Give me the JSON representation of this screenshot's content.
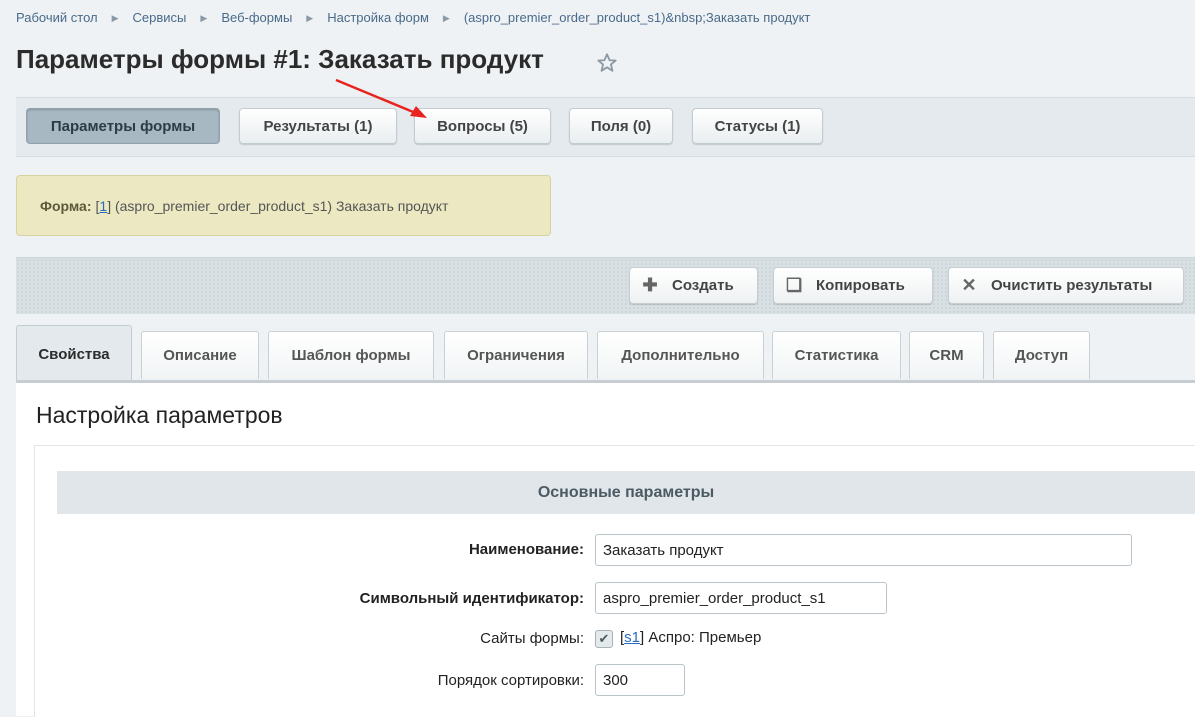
{
  "breadcrumb": [
    "Рабочий стол",
    "Сервисы",
    "Веб-формы",
    "Настройка форм",
    "(aspro_premier_order_product_s1)&nbsp;Заказать продукт"
  ],
  "page_title": "Параметры формы #1: Заказать продукт",
  "top_tabs": [
    "Параметры формы",
    "Результаты (1)",
    "Вопросы (5)",
    "Поля (0)",
    "Статусы (1)"
  ],
  "notice": {
    "label": "Форма:",
    "id_link": "1",
    "text": "(aspro_premier_order_product_s1) Заказать продукт"
  },
  "toolbar": {
    "create": "Создать",
    "copy": "Копировать",
    "clear": "Очистить результаты"
  },
  "tabs": [
    "Свойства",
    "Описание",
    "Шаблон формы",
    "Ограничения",
    "Дополнительно",
    "Статистика",
    "CRM",
    "Доступ"
  ],
  "panel_title": "Настройка параметров",
  "section_title": "Основные параметры",
  "fields": {
    "name_label": "Наименование:",
    "name_value": "Заказать продукт",
    "code_label": "Символьный идентификатор:",
    "code_value": "aspro_premier_order_product_s1",
    "sites_label": "Сайты формы:",
    "site_link": "s1",
    "site_name": "Аспро: Премьер",
    "sort_label": "Порядок сортировки:",
    "sort_value": "300"
  },
  "icons": [
    "star-icon",
    "plus-icon",
    "copy-icon",
    "close-icon",
    "check-icon",
    "chevron-right-icon"
  ],
  "colors": {
    "accent_link": "#2a6cbf",
    "notice_bg": "#ebe8c2",
    "active_tab": "#a8b8c2",
    "annotation_arrow": "#e8231f"
  }
}
